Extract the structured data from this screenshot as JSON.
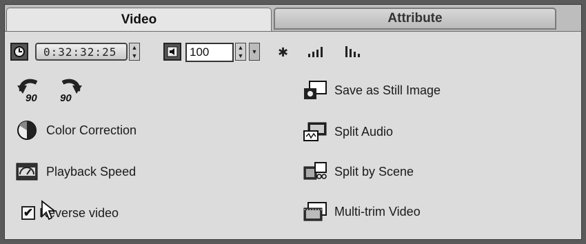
{
  "tabs": [
    {
      "label": "Video"
    },
    {
      "label": "Attribute"
    }
  ],
  "toolbar": {
    "timecode": "0:32:32:25",
    "volume": "100",
    "icons": [
      "clock-icon",
      "speaker-icon",
      "mute-icon",
      "volume-bars-icon",
      "volume-fade-icon"
    ]
  },
  "rotate": {
    "left_label": "90",
    "right_label": "90"
  },
  "left_items": [
    {
      "label": "Color Correction",
      "icon": "color-wheel-icon"
    },
    {
      "label": "Playback Speed",
      "icon": "speedometer-icon"
    },
    {
      "label": "Reverse video",
      "checked": true
    }
  ],
  "right_items": [
    {
      "label": "Save as Still Image",
      "icon": "camera-icon"
    },
    {
      "label": "Split Audio",
      "icon": "split-audio-icon"
    },
    {
      "label": "Split by Scene",
      "icon": "split-scene-icon"
    },
    {
      "label": "Multi-trim Video",
      "icon": "film-icon"
    }
  ],
  "colors": {
    "panel": "#dcdcdc",
    "tab_active": "#e6e6e6",
    "tab_inactive": "#c6c6c6",
    "text": "#1a1a1a"
  }
}
